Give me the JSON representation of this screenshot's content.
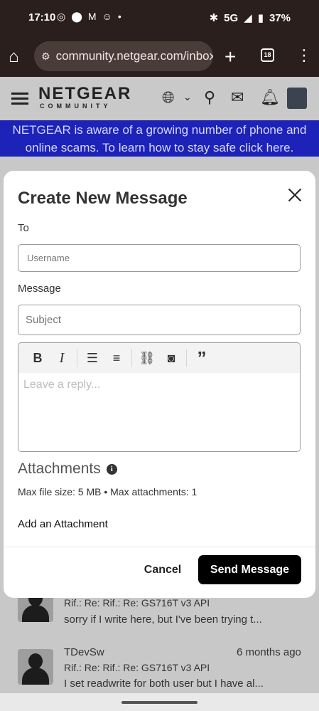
{
  "status_bar": {
    "time": "17:10",
    "signal": "5G",
    "battery": "37%",
    "left_icons": [
      "whatsapp-icon",
      "location-icon",
      "gmail-icon",
      "app-icon",
      "dot-icon"
    ],
    "right_icons": [
      "bluetooth-icon",
      "signal-icon",
      "battery-icon"
    ]
  },
  "browser": {
    "url": "community.netgear.com/inbox",
    "tab_count": "18"
  },
  "site": {
    "brand": "NETGEAR",
    "brand_sub": "COMMUNITY",
    "banner": "NETGEAR is aware of a growing number of phone and online scams. To learn how to stay safe click here."
  },
  "modal": {
    "title": "Create New Message",
    "to_label": "To",
    "username_placeholder": "Username",
    "message_label": "Message",
    "subject_placeholder": "Subject",
    "reply_placeholder": "Leave a reply...",
    "toolbar": [
      "bold",
      "italic",
      "bullet-list",
      "numbered-list",
      "link",
      "image",
      "quote"
    ],
    "attachments_title": "Attachments",
    "attachments_info": "Max file size: 5 MB • Max attachments: 1",
    "add_attachment": "Add an Attachment",
    "cancel": "Cancel",
    "send": "Send Message"
  },
  "background_messages": [
    {
      "author": "",
      "time": "",
      "subject": "Rif.: Re: Rif.: Re: GS716T v3 API",
      "snippet": "sorry if I write here, but I've been trying t..."
    },
    {
      "author": "TDevSw",
      "time": "6 months ago",
      "subject": "Rif.: Re: Rif.: Re: GS716T v3 API",
      "snippet": "I set readwrite for both user but I have al..."
    }
  ]
}
